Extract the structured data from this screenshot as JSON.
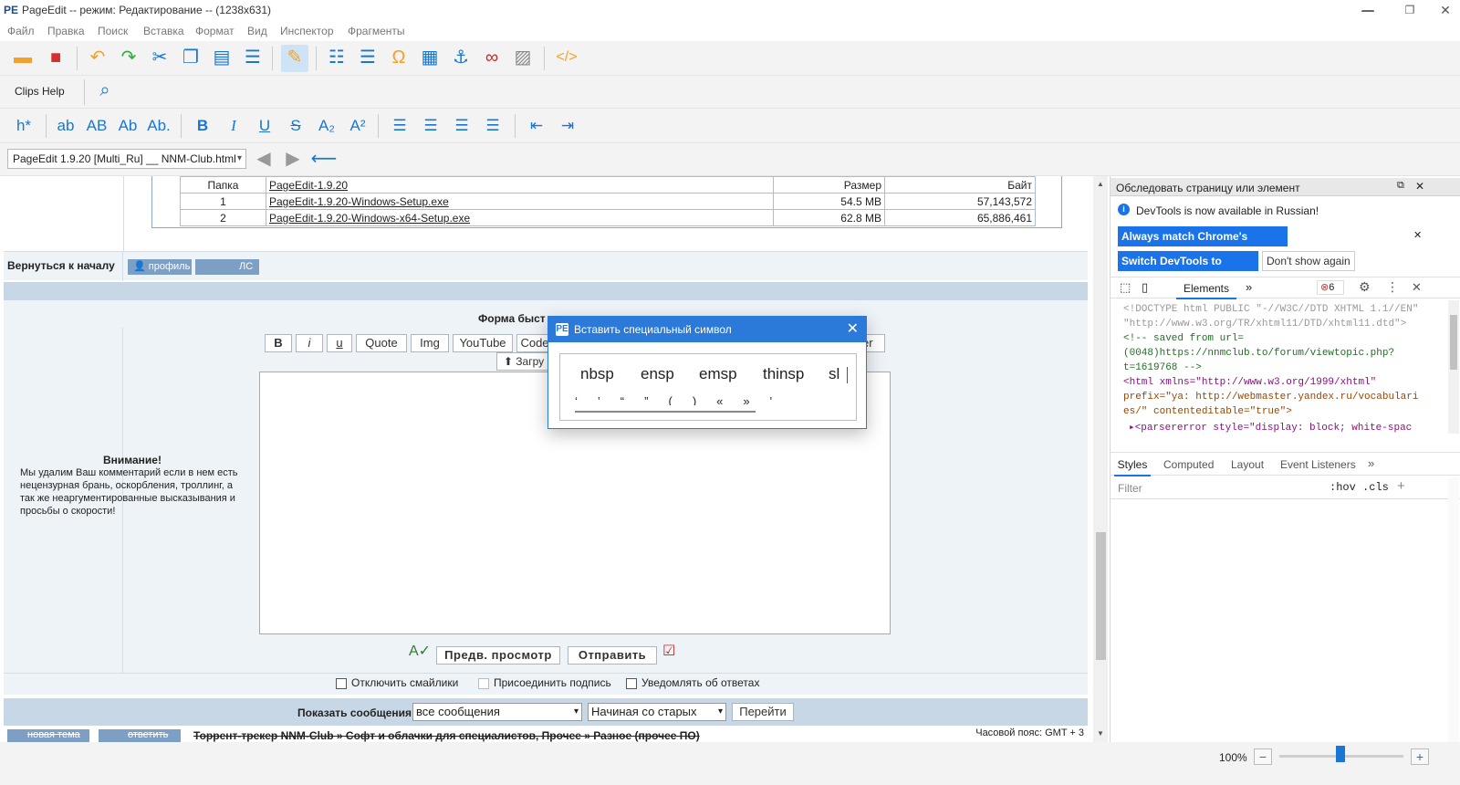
{
  "window": {
    "title": "PageEdit -- режим: Редактирование -- (1238x631)",
    "minimize": "—",
    "maximize": "❐",
    "close": "✕"
  },
  "menu": [
    "Файл",
    "Правка",
    "Поиск",
    "Вставка",
    "Формат",
    "Вид",
    "Инспектор",
    "Фрагменты"
  ],
  "toolbar": {
    "clips_label": "Clips Help",
    "heading_label": "h*",
    "case_buttons": [
      "ab",
      "AB",
      "Ab",
      "Ab."
    ],
    "format_buttons": [
      "B",
      "I",
      "U",
      "S"
    ],
    "sub_label": "A₂",
    "sup_label": "A²"
  },
  "path_select": "PageEdit 1.9.20 [Multi_Ru] __ NNM-Club.html",
  "file_table": {
    "header": [
      "Папка",
      "PageEdit-1.9.20",
      "Размер",
      "Байт"
    ],
    "rows": [
      [
        "1",
        "PageEdit-1.9.20-Windows-Setup.exe",
        "54.5 MB",
        "57,143,572"
      ],
      [
        "2",
        "PageEdit-1.9.20-Windows-x64-Setup.exe",
        "62.8 MB",
        "65,886,461"
      ]
    ]
  },
  "back_to_top": "Вернуться к началу",
  "profile_btn": "профиль",
  "pm_btn": "ЛС",
  "quick_form": {
    "title": "Форма быст",
    "tags": [
      "B",
      "i",
      "u",
      "Quote",
      "Img",
      "YouTube",
      "Code"
    ],
    "tag_right": "er",
    "upload_btn": "Загру",
    "warning_title": "Внимание!",
    "warning_text": "Мы удалим Ваш комментарий если в нем есть нецензурная брань, оскорбления, троллинг, а так же неаргументированные высказывания и просьбы о скорости!",
    "preview_btn": "Предв. просмотр",
    "send_btn": "Отправить",
    "checkbox_smilies": "Отключить смайлики",
    "checkbox_signature": "Присоединить подпись",
    "checkbox_notify": "Уведомлять об ответах"
  },
  "show_messages": {
    "label": "Показать сообщения:",
    "filter_value": "все сообщения",
    "order_value": "Начиная со старых",
    "go_btn": "Перейти"
  },
  "footer": {
    "new_topic": "новая тема",
    "reply": "ответить",
    "breadcrumb": "Торрент-трекер NNM-Club  » Софт и облачки для специалистов, Прочее  » Разное (прочее ПО)",
    "timezone": "Часовой пояс: GMT + 3"
  },
  "dialog": {
    "title": "Вставить специальный символ",
    "symbols": [
      "nbsp",
      "ensp",
      "emsp",
      "thinsp",
      "sl"
    ],
    "punct": [
      "‘",
      "’",
      "“",
      "”",
      "(",
      ")",
      "«",
      "»",
      "'"
    ]
  },
  "devtools": {
    "inspect_header": "Обследовать страницу или элемент",
    "notice": "DevTools is now available in Russian!",
    "btn_match": "Always match Chrome's language",
    "btn_switch": "Switch DevTools to Russian",
    "btn_dont": "Don't show again",
    "tab_elements": "Elements",
    "more_tabs": "»",
    "error_count": "6",
    "code_lines": [
      "<!DOCTYPE html PUBLIC \"-//W3C//DTD XHTML 1.1//EN\"",
      "\"http://www.w3.org/TR/xhtml11/DTD/xhtml11.dtd\">",
      "<!-- saved from url=",
      "(0048)https://nnmclub.to/forum/viewtopic.php?",
      "t=1619768 -->",
      "<html xmlns=\"http://www.w3.org/1999/xhtml\"",
      "prefix=\"ya: http://webmaster.yandex.ru/vocabulari",
      "es/\" contenteditable=\"true\">",
      "▸<parsererror style=\"display: block; white-spac"
    ],
    "styles_tabs": [
      "Styles",
      "Computed",
      "Layout",
      "Event Listeners",
      "»"
    ],
    "filter_placeholder": "Filter",
    "hov": ":hov",
    "cls": ".cls",
    "plus": "+"
  },
  "status": {
    "zoom": "100%",
    "minus": "−",
    "plus": "+"
  }
}
